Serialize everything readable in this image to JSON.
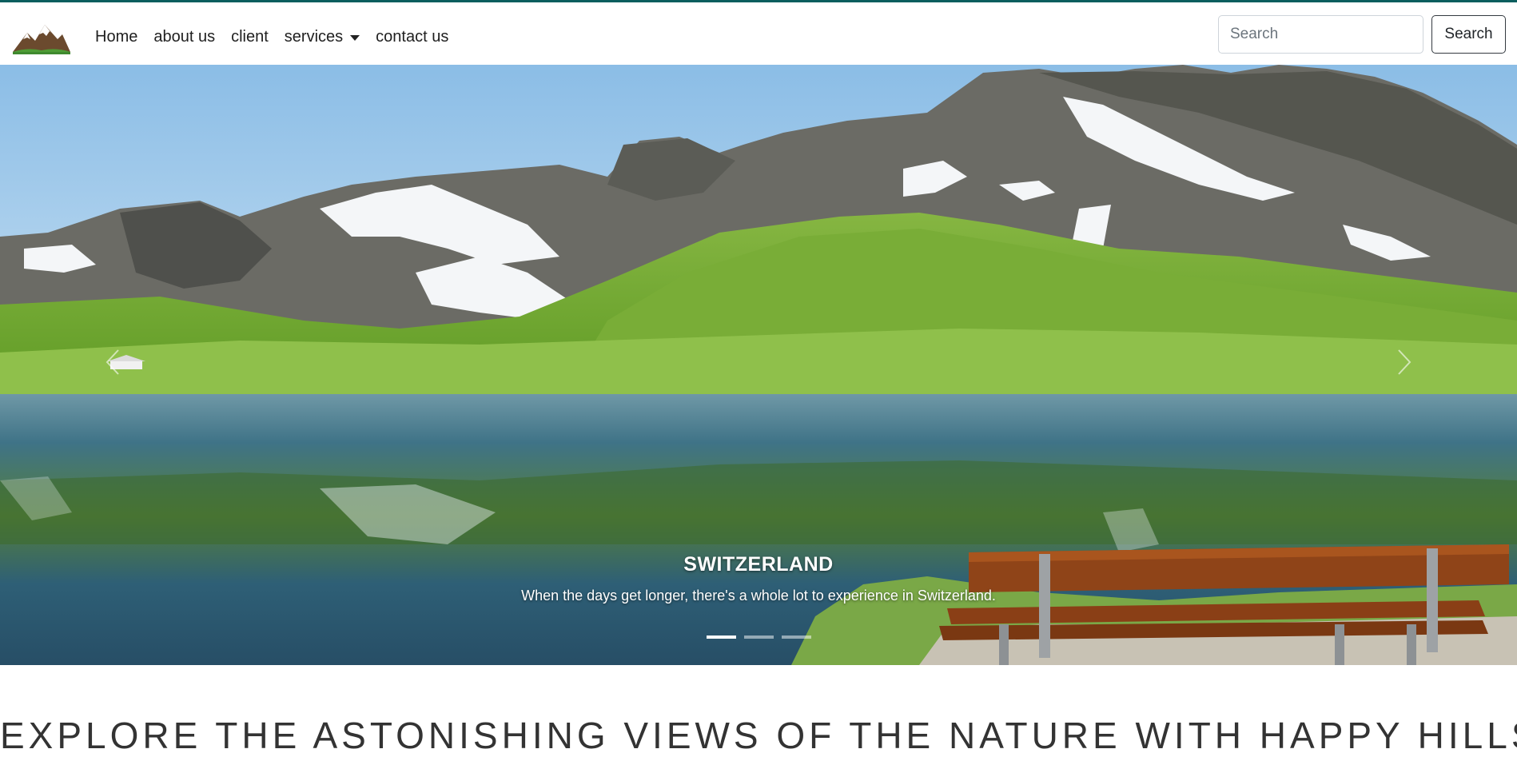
{
  "nav": {
    "links": [
      "Home",
      "about us",
      "client",
      "services",
      "contact us"
    ],
    "search_placeholder": "Search",
    "search_button": "Search"
  },
  "carousel": {
    "caption_title": "SWITZERLAND",
    "caption_text": "When the days get longer, there's a whole lot to experience in Switzerland.",
    "slide_count": 3,
    "active_index": 0
  },
  "headline": "EXPLORE THE ASTONISHING VIEWS OF THE NATURE WITH HAPPY HILLS !",
  "colors": {
    "top_border": "#0b5e5e",
    "sky": "#9cc6eb",
    "grass": "#6aa42c",
    "lake": "#3b6f86",
    "bench": "#8f4418"
  }
}
